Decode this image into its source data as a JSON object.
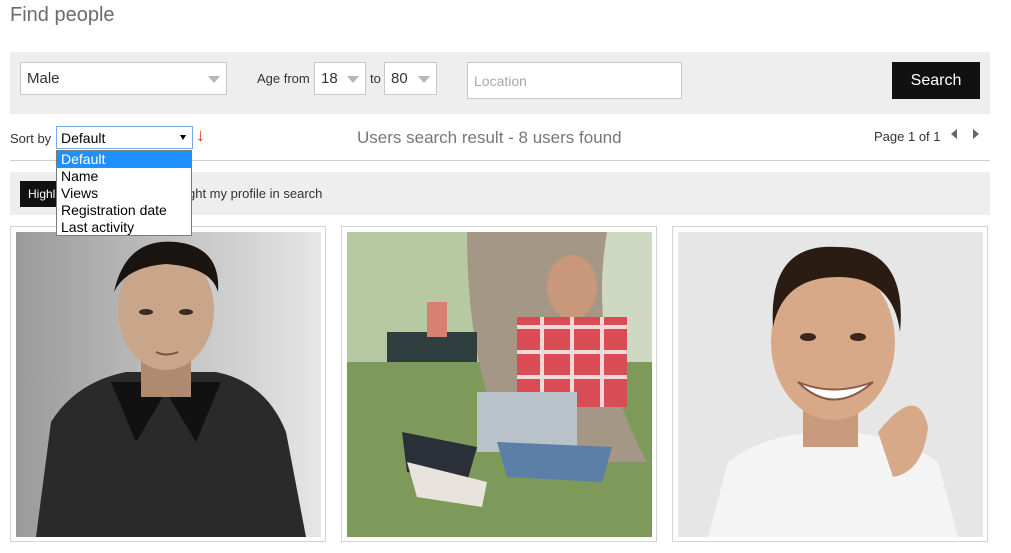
{
  "page": {
    "title": "Find people"
  },
  "filters": {
    "gender": "Male",
    "age_label": "Age from",
    "age_from": "18",
    "to_label": "to",
    "age_to": "80",
    "location_placeholder": "Location",
    "search_label": "Search"
  },
  "sort": {
    "label": "Sort by",
    "selected": "Default",
    "options": [
      "Default",
      "Name",
      "Views",
      "Registration date",
      "Last activity"
    ]
  },
  "results": {
    "summary": "Users search result - 8 users found",
    "pager": "Page 1 of 1"
  },
  "highlight": {
    "button_label": "Highlight",
    "text": "ght my profile in search"
  },
  "cards": [
    {
      "icon": "profile-photo-man-dark-jacket"
    },
    {
      "icon": "profile-photo-man-laptop-tree"
    },
    {
      "icon": "profile-photo-man-smiling"
    }
  ],
  "colors": {
    "accent_dark": "#111111",
    "selection": "#1e90ff",
    "panel": "#eeeeee"
  }
}
